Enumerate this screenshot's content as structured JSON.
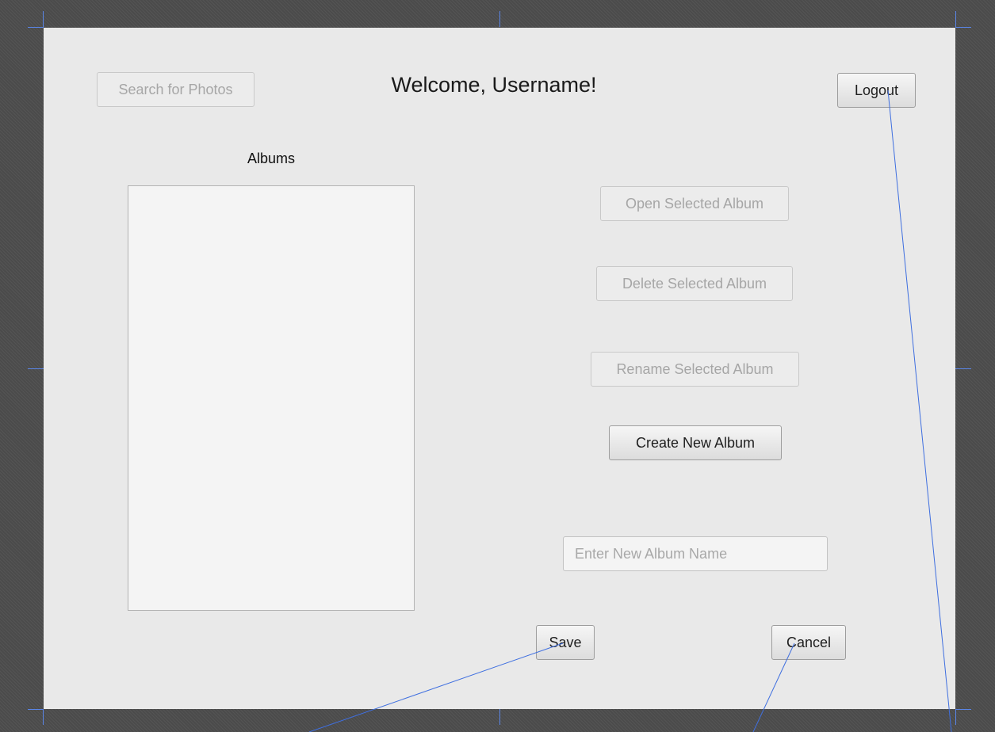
{
  "header": {
    "search_label": "Search for Photos",
    "welcome_text": "Welcome, Username!",
    "logout_label": "Logout"
  },
  "albums": {
    "label": "Albums",
    "items": []
  },
  "actions": {
    "open_label": "Open Selected Album",
    "delete_label": "Delete Selected Album",
    "rename_label": "Rename Selected Album",
    "create_label": "Create New Album"
  },
  "new_album": {
    "placeholder": "Enter New Album Name",
    "value": ""
  },
  "footer": {
    "save_label": "Save",
    "cancel_label": "Cancel"
  },
  "colors": {
    "designer_background": "#4b4b4b",
    "window_background": "#e9e9e9",
    "list_background": "#f4f4f4",
    "guide_lines": "#5a86e8"
  }
}
